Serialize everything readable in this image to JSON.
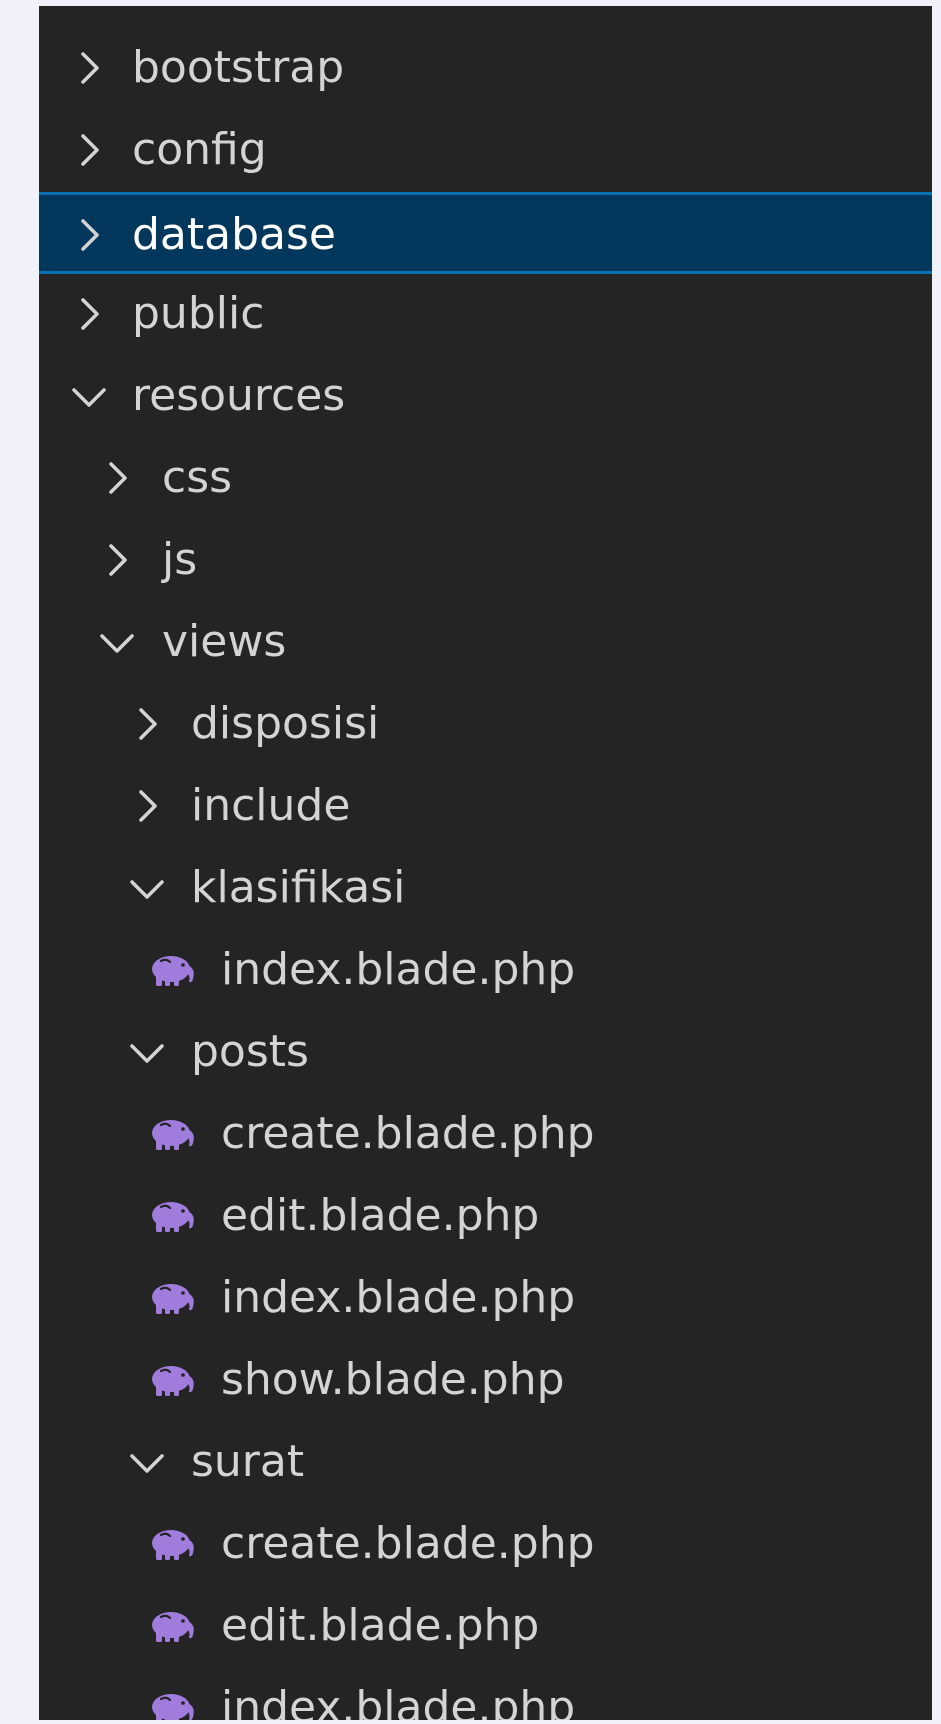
{
  "explorer": {
    "rows": [
      {
        "label": "bootstrap",
        "kind": "folder",
        "expanded": false,
        "depth": 0,
        "selected": false
      },
      {
        "label": "config",
        "kind": "folder",
        "expanded": false,
        "depth": 0,
        "selected": false
      },
      {
        "label": "database",
        "kind": "folder",
        "expanded": false,
        "depth": 0,
        "selected": true
      },
      {
        "label": "public",
        "kind": "folder",
        "expanded": false,
        "depth": 0,
        "selected": false
      },
      {
        "label": "resources",
        "kind": "folder",
        "expanded": true,
        "depth": 0,
        "selected": false
      },
      {
        "label": "css",
        "kind": "folder",
        "expanded": false,
        "depth": 1,
        "selected": false
      },
      {
        "label": "js",
        "kind": "folder",
        "expanded": false,
        "depth": 1,
        "selected": false
      },
      {
        "label": "views",
        "kind": "folder",
        "expanded": true,
        "depth": 1,
        "selected": false
      },
      {
        "label": "disposisi",
        "kind": "folder",
        "expanded": false,
        "depth": 2,
        "selected": false
      },
      {
        "label": "include",
        "kind": "folder",
        "expanded": false,
        "depth": 2,
        "selected": false
      },
      {
        "label": "klasifikasi",
        "kind": "folder",
        "expanded": true,
        "depth": 2,
        "selected": false
      },
      {
        "label": "index.blade.php",
        "kind": "file",
        "icon": "php-elephant-icon",
        "depth": 3,
        "selected": false
      },
      {
        "label": "posts",
        "kind": "folder",
        "expanded": true,
        "depth": 2,
        "selected": false
      },
      {
        "label": "create.blade.php",
        "kind": "file",
        "icon": "php-elephant-icon",
        "depth": 3,
        "selected": false
      },
      {
        "label": "edit.blade.php",
        "kind": "file",
        "icon": "php-elephant-icon",
        "depth": 3,
        "selected": false
      },
      {
        "label": "index.blade.php",
        "kind": "file",
        "icon": "php-elephant-icon",
        "depth": 3,
        "selected": false
      },
      {
        "label": "show.blade.php",
        "kind": "file",
        "icon": "php-elephant-icon",
        "depth": 3,
        "selected": false
      },
      {
        "label": "surat",
        "kind": "folder",
        "expanded": true,
        "depth": 2,
        "selected": false
      },
      {
        "label": "create.blade.php",
        "kind": "file",
        "icon": "php-elephant-icon",
        "depth": 3,
        "selected": false
      },
      {
        "label": "edit.blade.php",
        "kind": "file",
        "icon": "php-elephant-icon",
        "depth": 3,
        "selected": false
      },
      {
        "label": "index.blade.php",
        "kind": "file",
        "icon": "php-elephant-icon",
        "depth": 3,
        "selected": false
      }
    ]
  },
  "colors": {
    "page_background": "#f1f1fb",
    "panel_background": "#242424",
    "text": "#d4d4d4",
    "selected_background": "#03385c",
    "selected_border": "#0b6fb3",
    "php_icon": "#a07cdd"
  }
}
